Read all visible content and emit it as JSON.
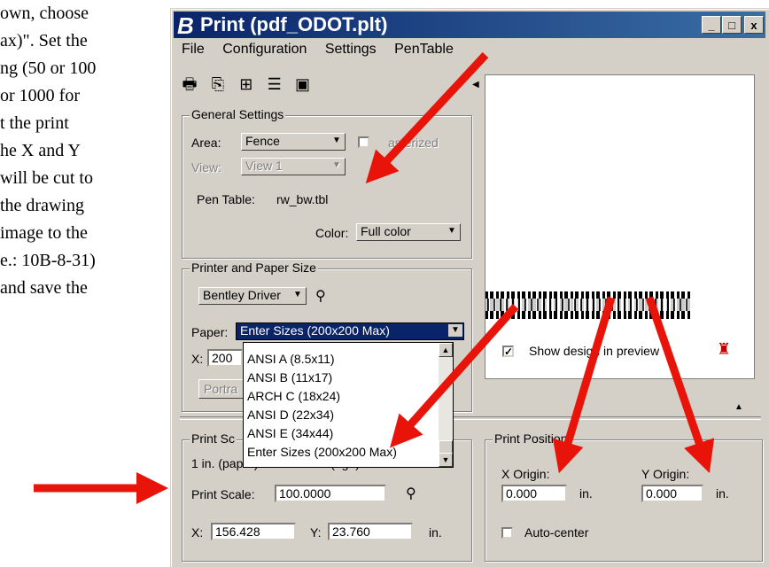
{
  "doc_text": {
    "lines": [
      "own, choose",
      "ax)\". Set the",
      "ng (50 or 100",
      "or 1000 for",
      "t the print",
      "he X and Y",
      "will be cut to",
      "the drawing",
      "image to the",
      "e.: 10B-8-31)",
      "and save the"
    ]
  },
  "window": {
    "title_icon": "B",
    "title": "Print  (pdf_ODOT.plt)",
    "controls": {
      "minimize": "_",
      "maximize": "□",
      "close": "x"
    }
  },
  "menu": {
    "items": [
      "File",
      "Configuration",
      "Settings",
      "PenTable"
    ]
  },
  "toolbar": {
    "icons": [
      "printer-icon",
      "print-preview-icon",
      "maximize-area-icon",
      "list-icon",
      "printer-setup-icon"
    ]
  },
  "general_settings": {
    "label": "General Settings",
    "area_label": "Area:",
    "area_value": "Fence",
    "rasterized_label": "asterized",
    "view_label": "View:",
    "view_value": "View 1",
    "pen_table_label": "Pen Table:",
    "pen_table_value": "rw_bw.tbl",
    "color_label": "Color:",
    "color_value": "Full color"
  },
  "printer_paper": {
    "label": "Printer and Paper Size",
    "driver": "Bentley Driver",
    "paper_label": "Paper:",
    "paper_value": "Enter Sizes (200x200 Max)",
    "x_label": "X:",
    "x_value": "200",
    "orientation_value": "Portra",
    "paper_options": [
      "ANSI A (8.5x11)",
      "ANSI B (11x17)",
      "ARCH C (18x24)",
      "ANSI D (22x34)",
      "ANSI E (34x44)",
      "Enter Sizes (200x200 Max)"
    ]
  },
  "print_scale": {
    "label": "Print Sc",
    "ratio_text": "1 in. (paper) to 100.0000 (dgn)",
    "scale_label": "Print Scale:",
    "scale_value": "100.0000",
    "x_label": "X:",
    "x_value": "156.428",
    "y_label": "Y:",
    "y_value": "23.760",
    "unit": "in."
  },
  "preview": {
    "show_design_label": "Show design in preview"
  },
  "print_position": {
    "label": "Print Position",
    "x_origin_label": "X Origin:",
    "x_origin_value": "0.000",
    "y_origin_label": "Y Origin:",
    "y_origin_value": "0.000",
    "unit": "in.",
    "auto_center_label": "Auto-center"
  },
  "colors": {
    "title_start": "#0a246a",
    "title_end": "#3a6ea5",
    "window_bg": "#d4d0c8",
    "selection": "#0a246a",
    "annotation_arrow": "#e8140a"
  }
}
